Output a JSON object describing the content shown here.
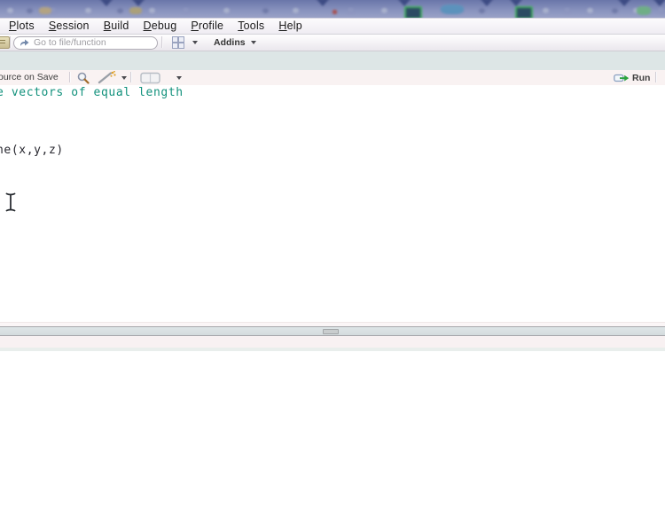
{
  "menu": {
    "items": [
      {
        "mnemonic": "P",
        "rest": "lots"
      },
      {
        "mnemonic": "S",
        "rest": "ession"
      },
      {
        "mnemonic": "B",
        "rest": "uild"
      },
      {
        "mnemonic": "D",
        "rest": "ebug"
      },
      {
        "mnemonic": "P",
        "rest": "rofile"
      },
      {
        "mnemonic": "T",
        "rest": "ools"
      },
      {
        "mnemonic": "H",
        "rest": "elp"
      }
    ]
  },
  "toolbar": {
    "search_placeholder": "Go to file/function",
    "addins_label": "Addins"
  },
  "source_pane": {
    "toolbar": {
      "source_on_save_label": "ource on Save",
      "run_label": "Run"
    },
    "code": {
      "line1": "e vectors of equal length",
      "line2": "ne(x,y,z)"
    }
  },
  "colors": {
    "comment_green": "#12917C",
    "run_arrow_green": "#2AA23C",
    "top_strip_blue": "#8791BD",
    "editor_text": "#26262E"
  }
}
